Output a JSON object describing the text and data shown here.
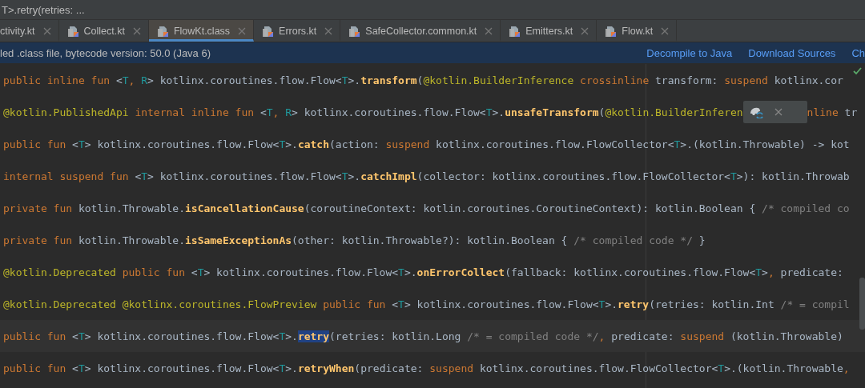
{
  "breadcrumb": "T>.retry(retries: ...",
  "tabs": [
    {
      "label": "ctivity.kt",
      "icon": false,
      "selected": false
    },
    {
      "label": "Collect.kt",
      "icon": true,
      "selected": false
    },
    {
      "label": "FlowKt.class",
      "icon": true,
      "selected": true
    },
    {
      "label": "Errors.kt",
      "icon": true,
      "selected": false
    },
    {
      "label": "SafeCollector.common.kt",
      "icon": true,
      "selected": false
    },
    {
      "label": "Emitters.kt",
      "icon": true,
      "selected": false
    },
    {
      "label": "Flow.kt",
      "icon": true,
      "selected": false
    }
  ],
  "banner": {
    "message": "led .class file, bytecode version: 50.0 (Java 6)",
    "links": [
      "Decompile to Java",
      "Download Sources",
      "Ch"
    ]
  },
  "lines": [
    {
      "current": false,
      "tokens": [
        {
          "kind": "kw",
          "text": "public inline fun "
        },
        {
          "kind": "txt",
          "text": "<"
        },
        {
          "kind": "tp",
          "text": "T"
        },
        {
          "kind": "comma",
          "text": ", "
        },
        {
          "kind": "tp",
          "text": "R"
        },
        {
          "kind": "txt",
          "text": "> kotlinx.coroutines.flow.Flow<"
        },
        {
          "kind": "tp",
          "text": "T"
        },
        {
          "kind": "txt",
          "text": ">."
        },
        {
          "kind": "fn",
          "text": "transform"
        },
        {
          "kind": "txt",
          "text": "("
        },
        {
          "kind": "ann",
          "text": "@kotlin.BuilderInference "
        },
        {
          "kind": "kw",
          "text": "crossinline "
        },
        {
          "kind": "txt",
          "text": "transform: "
        },
        {
          "kind": "kw",
          "text": "suspend "
        },
        {
          "kind": "txt",
          "text": "kotlinx.cor"
        }
      ]
    },
    {
      "current": false,
      "tokens": [
        {
          "kind": "ann",
          "text": "@kotlin.PublishedApi "
        },
        {
          "kind": "kw",
          "text": "internal inline fun "
        },
        {
          "kind": "txt",
          "text": "<"
        },
        {
          "kind": "tp",
          "text": "T"
        },
        {
          "kind": "comma",
          "text": ", "
        },
        {
          "kind": "tp",
          "text": "R"
        },
        {
          "kind": "txt",
          "text": "> kotlinx.coroutines.flow.Flow<"
        },
        {
          "kind": "tp",
          "text": "T"
        },
        {
          "kind": "txt",
          "text": ">."
        },
        {
          "kind": "fn",
          "text": "unsafeTransform"
        },
        {
          "kind": "txt",
          "text": "("
        },
        {
          "kind": "ann",
          "text": "@kotlin.BuilderInferen"
        }
      ],
      "tokens_after_popup": [
        {
          "kind": "kw",
          "text": "nline "
        },
        {
          "kind": "txt",
          "text": "tr"
        }
      ]
    },
    {
      "current": false,
      "tokens": [
        {
          "kind": "kw",
          "text": "public fun "
        },
        {
          "kind": "txt",
          "text": "<"
        },
        {
          "kind": "tp",
          "text": "T"
        },
        {
          "kind": "txt",
          "text": "> kotlinx.coroutines.flow.Flow<"
        },
        {
          "kind": "tp",
          "text": "T"
        },
        {
          "kind": "txt",
          "text": ">."
        },
        {
          "kind": "fn",
          "text": "catch"
        },
        {
          "kind": "txt",
          "text": "(action: "
        },
        {
          "kind": "kw",
          "text": "suspend "
        },
        {
          "kind": "txt",
          "text": "kotlinx.coroutines.flow.FlowCollector<"
        },
        {
          "kind": "tp",
          "text": "T"
        },
        {
          "kind": "txt",
          "text": ">.(kotlin.Throwable) -> kot"
        }
      ]
    },
    {
      "current": false,
      "tokens": [
        {
          "kind": "kw",
          "text": "internal suspend fun "
        },
        {
          "kind": "txt",
          "text": "<"
        },
        {
          "kind": "tp",
          "text": "T"
        },
        {
          "kind": "txt",
          "text": "> kotlinx.coroutines.flow.Flow<"
        },
        {
          "kind": "tp",
          "text": "T"
        },
        {
          "kind": "txt",
          "text": ">."
        },
        {
          "kind": "fn",
          "text": "catchImpl"
        },
        {
          "kind": "txt",
          "text": "(collector: kotlinx.coroutines.flow.FlowCollector<"
        },
        {
          "kind": "tp",
          "text": "T"
        },
        {
          "kind": "txt",
          "text": ">): kotlin.Throwab"
        }
      ]
    },
    {
      "current": false,
      "tokens": [
        {
          "kind": "kw",
          "text": "private fun "
        },
        {
          "kind": "txt",
          "text": "kotlin.Throwable."
        },
        {
          "kind": "fn",
          "text": "isCancellationCause"
        },
        {
          "kind": "txt",
          "text": "(coroutineContext: kotlin.coroutines.CoroutineContext): kotlin.Boolean { "
        },
        {
          "kind": "cm",
          "text": "/* compiled co"
        }
      ]
    },
    {
      "current": false,
      "tokens": [
        {
          "kind": "kw",
          "text": "private fun "
        },
        {
          "kind": "txt",
          "text": "kotlin.Throwable."
        },
        {
          "kind": "fn",
          "text": "isSameExceptionAs"
        },
        {
          "kind": "txt",
          "text": "(other: kotlin.Throwable?): kotlin.Boolean { "
        },
        {
          "kind": "cm",
          "text": "/* compiled code */"
        },
        {
          "kind": "txt",
          "text": " }"
        }
      ]
    },
    {
      "current": false,
      "tokens": [
        {
          "kind": "ann",
          "text": "@kotlin.Deprecated "
        },
        {
          "kind": "kw",
          "text": "public fun "
        },
        {
          "kind": "txt",
          "text": "<"
        },
        {
          "kind": "tp",
          "text": "T"
        },
        {
          "kind": "txt",
          "text": "> kotlinx.coroutines.flow.Flow<"
        },
        {
          "kind": "tp",
          "text": "T"
        },
        {
          "kind": "txt",
          "text": ">."
        },
        {
          "kind": "fn",
          "text": "onErrorCollect"
        },
        {
          "kind": "txt",
          "text": "(fallback: kotlinx.coroutines.flow.Flow<"
        },
        {
          "kind": "tp",
          "text": "T"
        },
        {
          "kind": "txt",
          "text": ">"
        },
        {
          "kind": "comma",
          "text": ", "
        },
        {
          "kind": "txt",
          "text": "predicate:"
        }
      ]
    },
    {
      "current": false,
      "tokens": [
        {
          "kind": "ann",
          "text": "@kotlin.Deprecated @kotlinx.coroutines.FlowPreview "
        },
        {
          "kind": "kw",
          "text": "public fun "
        },
        {
          "kind": "txt",
          "text": "<"
        },
        {
          "kind": "tp",
          "text": "T"
        },
        {
          "kind": "txt",
          "text": "> kotlinx.coroutines.flow.Flow<"
        },
        {
          "kind": "tp",
          "text": "T"
        },
        {
          "kind": "txt",
          "text": ">."
        },
        {
          "kind": "fn",
          "text": "retry"
        },
        {
          "kind": "txt",
          "text": "(retries: kotlin.Int "
        },
        {
          "kind": "cm",
          "text": "/* = compil"
        }
      ]
    },
    {
      "current": true,
      "tokens": [
        {
          "kind": "kw",
          "text": "public fun "
        },
        {
          "kind": "txt",
          "text": "<"
        },
        {
          "kind": "tp",
          "text": "T"
        },
        {
          "kind": "txt",
          "text": "> kotlinx.coroutines.flow.Flow<"
        },
        {
          "kind": "tp",
          "text": "T"
        },
        {
          "kind": "txt",
          "text": ">."
        },
        {
          "kind": "match",
          "text": "retry"
        },
        {
          "kind": "txt",
          "text": "(retries: kotlin.Long "
        },
        {
          "kind": "cm",
          "text": "/* = compiled code */"
        },
        {
          "kind": "comma",
          "text": ", "
        },
        {
          "kind": "txt",
          "text": "predicate: "
        },
        {
          "kind": "kw",
          "text": "suspend "
        },
        {
          "kind": "txt",
          "text": "(kotlin.Throwable)"
        }
      ]
    },
    {
      "current": false,
      "tokens": [
        {
          "kind": "kw",
          "text": "public fun "
        },
        {
          "kind": "txt",
          "text": "<"
        },
        {
          "kind": "tp",
          "text": "T"
        },
        {
          "kind": "txt",
          "text": "> kotlinx.coroutines.flow.Flow<"
        },
        {
          "kind": "tp",
          "text": "T"
        },
        {
          "kind": "txt",
          "text": ">."
        },
        {
          "kind": "fn",
          "text": "retryWhen"
        },
        {
          "kind": "txt",
          "text": "(predicate: "
        },
        {
          "kind": "kw",
          "text": "suspend "
        },
        {
          "kind": "txt",
          "text": "kotlinx.coroutines.flow.FlowCollector<"
        },
        {
          "kind": "tp",
          "text": "T"
        },
        {
          "kind": "txt",
          "text": ">.(kotlin.Throwable"
        },
        {
          "kind": "comma",
          "text": ","
        }
      ]
    }
  ]
}
